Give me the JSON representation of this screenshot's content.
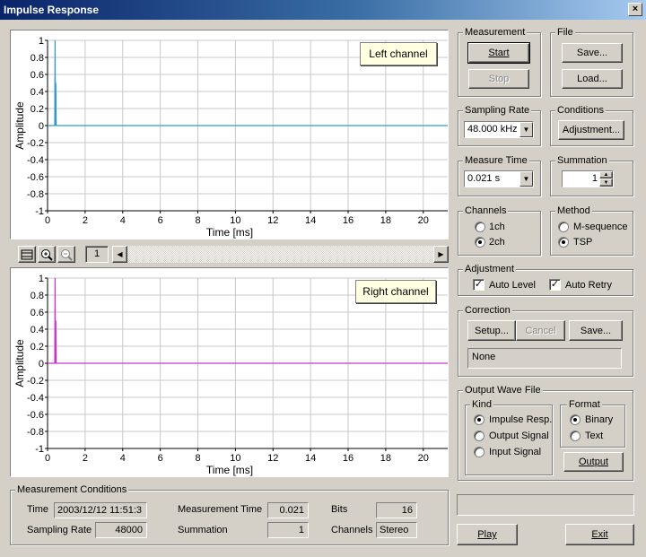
{
  "window": {
    "title": "Impulse Response",
    "close_glyph": "×"
  },
  "plots": [
    {
      "label": "Left channel",
      "color": "#3399cc",
      "ylabel": "Amplitude",
      "xlabel": "Time [ms]",
      "xticks": [
        "0",
        "2",
        "4",
        "6",
        "8",
        "10",
        "12",
        "14",
        "16",
        "18",
        "20"
      ],
      "yticks": [
        "1",
        "0.8",
        "0.6",
        "0.4",
        "0.2",
        "0",
        "-0.2",
        "-0.4",
        "-0.6",
        "-0.8",
        "-1"
      ]
    },
    {
      "label": "Right channel",
      "color": "#cc33cc",
      "ylabel": "Amplitude",
      "xlabel": "Time [ms]",
      "xticks": [
        "0",
        "2",
        "4",
        "6",
        "8",
        "10",
        "12",
        "14",
        "16",
        "18",
        "20"
      ],
      "yticks": [
        "1",
        "0.8",
        "0.6",
        "0.4",
        "0.2",
        "0",
        "-0.2",
        "-0.4",
        "-0.6",
        "-0.8",
        "-1"
      ]
    }
  ],
  "chart_data": [
    {
      "type": "line",
      "title": "Left channel",
      "xlabel": "Time [ms]",
      "ylabel": "Amplitude",
      "xlim": [
        0,
        21.3
      ],
      "ylim": [
        -1,
        1
      ],
      "x": [
        0,
        0.38,
        0.4,
        0.42,
        0.44,
        0.46,
        0.5,
        21.3
      ],
      "y": [
        0,
        0,
        1,
        0,
        0.5,
        0,
        0,
        0
      ]
    },
    {
      "type": "line",
      "title": "Right channel",
      "xlabel": "Time [ms]",
      "ylabel": "Amplitude",
      "xlim": [
        0,
        21.3
      ],
      "ylim": [
        -1,
        1
      ],
      "x": [
        0,
        0.38,
        0.4,
        0.42,
        0.44,
        0.46,
        0.5,
        21.3
      ],
      "y": [
        0,
        0,
        1,
        0,
        0.5,
        0,
        0,
        0
      ]
    }
  ],
  "toolbar": {
    "page_value": "1"
  },
  "measurement": {
    "title": "Measurement",
    "start": "Start",
    "stop": "Stop"
  },
  "file": {
    "title": "File",
    "save": "Save...",
    "load": "Load..."
  },
  "sampling_rate": {
    "title": "Sampling Rate",
    "value": "48.000 kHz"
  },
  "conditions": {
    "title": "Conditions",
    "adjustment": "Adjustment..."
  },
  "measure_time": {
    "title": "Measure Time",
    "value": "0.021 s"
  },
  "summation": {
    "title": "Summation",
    "value": "1"
  },
  "channels": {
    "title": "Channels",
    "opt1": "1ch",
    "opt2": "2ch",
    "selected": "2ch"
  },
  "method": {
    "title": "Method",
    "opt1": "M-sequence",
    "opt2": "TSP",
    "selected": "TSP"
  },
  "adjustment": {
    "title": "Adjustment",
    "auto_level": "Auto Level",
    "auto_retry": "Auto Retry",
    "auto_level_checked": true,
    "auto_retry_checked": true
  },
  "correction": {
    "title": "Correction",
    "setup": "Setup...",
    "cancel": "Cancel",
    "save": "Save...",
    "value": "None"
  },
  "output": {
    "title": "Output Wave File",
    "kind_title": "Kind",
    "kind1": "Impulse Resp.",
    "kind2": "Output Signal",
    "kind3": "Input Signal",
    "kind_selected": "Impulse Resp.",
    "format_title": "Format",
    "format1": "Binary",
    "format2": "Text",
    "format_selected": "Binary",
    "output_button": "Output"
  },
  "conds": {
    "title": "Measurement Conditions",
    "time_label": "Time",
    "time_value": "2003/12/12 11:51:3",
    "rate_label": "Sampling Rate",
    "rate_value": "48000",
    "mtime_label": "Measurement Time",
    "mtime_value": "0.021",
    "sum_label": "Summation",
    "sum_value": "1",
    "bits_label": "Bits",
    "bits_value": "16",
    "ch_label": "Channels",
    "ch_value": "Stereo"
  },
  "bottom": {
    "play": "Play",
    "exit": "Exit",
    "status": ""
  }
}
